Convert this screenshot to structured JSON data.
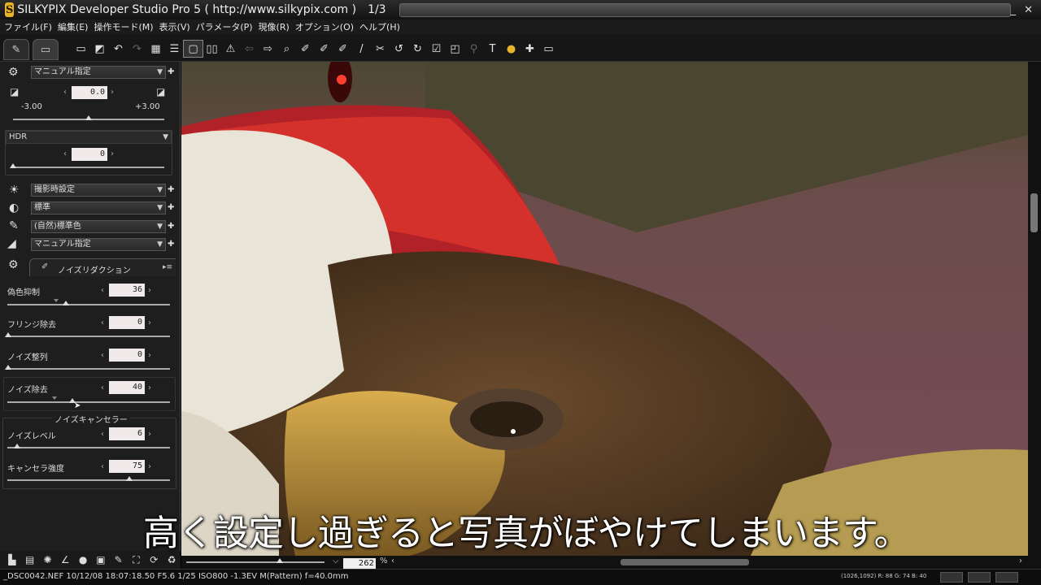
{
  "window": {
    "title": "SILKYPIX Developer Studio Pro 5 ( http://www.silkypix.com )",
    "page_counter": "1/3",
    "logo_letter": "S",
    "minimize": "_",
    "close": "✕"
  },
  "menu": [
    "ファイル(F)",
    "編集(E)",
    "操作モード(M)",
    "表示(V)",
    "パラメータ(P)",
    "現像(R)",
    "オプション(O)",
    "ヘルプ(H)"
  ],
  "panel": {
    "exposure_preset": "マニュアル指定",
    "exposure_value": "0.0",
    "exposure_min": "-3.00",
    "exposure_max": "+3.00",
    "hdr_label": "HDR",
    "hdr_value": "0",
    "white_balance": "撮影時設定",
    "tone": "標準",
    "color": "(自然)標準色",
    "sharpness": "マニュアル指定",
    "noise_tab_label": "ノイズリダクション",
    "false_color_label": "偽色抑制",
    "false_color_value": "36",
    "false_color_level": 0.36,
    "fringe_label": "フリンジ除去",
    "fringe_value": "0",
    "noise_align_label": "ノイズ整列",
    "noise_align_value": "0",
    "noise_removal_label": "ノイズ除去",
    "noise_removal_value": "40",
    "noise_removal_level": 0.4,
    "canceller_title": "ノイズキャンセラー",
    "noise_level_label": "ノイズレベル",
    "noise_level_value": "6",
    "canceller_strength_label": "キャンセラ強度",
    "canceller_strength_value": "75",
    "canceller_strength_level": 0.75
  },
  "viewer": {
    "zoom": "262",
    "zoom_unit": "%",
    "caption": "高く設定し過ぎると写真がぼやけてしまいます。"
  },
  "status": {
    "file_info": "_DSC0042.NEF 10/12/08 18:07:18.50 F5.6 1/25 ISO800 -1.3EV M(Pattern) f=40.0mm",
    "pixel_readout": "(1026,1092) R: 88 G: 74 B: 40"
  },
  "colors": {
    "panel_bg": "#1e1e1e",
    "accent_gold": "#e8b32a"
  }
}
